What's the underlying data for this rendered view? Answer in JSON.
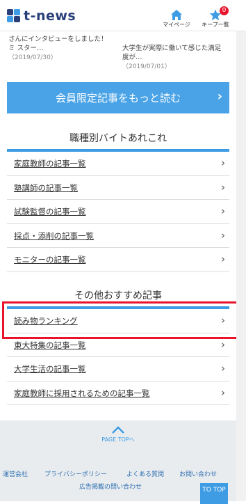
{
  "header": {
    "logo_text": "t-news",
    "mypage_label": "マイページ",
    "keep_label": "キープ一覧",
    "keep_count": "0"
  },
  "snippets": [
    {
      "text": "さんにインタビューをしました！ミ スター…",
      "date": "（2019/07/30）"
    },
    {
      "text": "大学生が実際に働いて感じた満足度が…",
      "date": "（2019/07/01）"
    }
  ],
  "member_button": {
    "label": "会員限定記事をもっと読む",
    "arrow": "›"
  },
  "job_section": {
    "title": "職種別バイトあれこれ",
    "items": [
      {
        "label": "家庭教師の記事一覧"
      },
      {
        "label": "塾講師の記事一覧"
      },
      {
        "label": "試験監督の記事一覧"
      },
      {
        "label": "採点・添削の記事一覧"
      },
      {
        "label": "モニターの記事一覧"
      }
    ]
  },
  "other_section": {
    "title": "その他おすすめ記事",
    "items": [
      {
        "label": "読み物ランキング"
      },
      {
        "label": "東大特集の記事一覧"
      },
      {
        "label": "大学生活の記事一覧"
      },
      {
        "label": "家庭教師に採用されるための記事一覧"
      }
    ]
  },
  "footer": {
    "pagetop_label": "PAGE TOPへ",
    "links": {
      "company": "運営会社",
      "privacy": "プライバシーポリシー",
      "faq": "よくある質問",
      "contact": "お問い合わせ",
      "ads": "広告掲載の問い合わせ"
    },
    "to_top_label": "TO TOP"
  },
  "colors": {
    "accent": "#3d9ce4",
    "badge": "#e8142b",
    "highlight": "#e8142b"
  }
}
